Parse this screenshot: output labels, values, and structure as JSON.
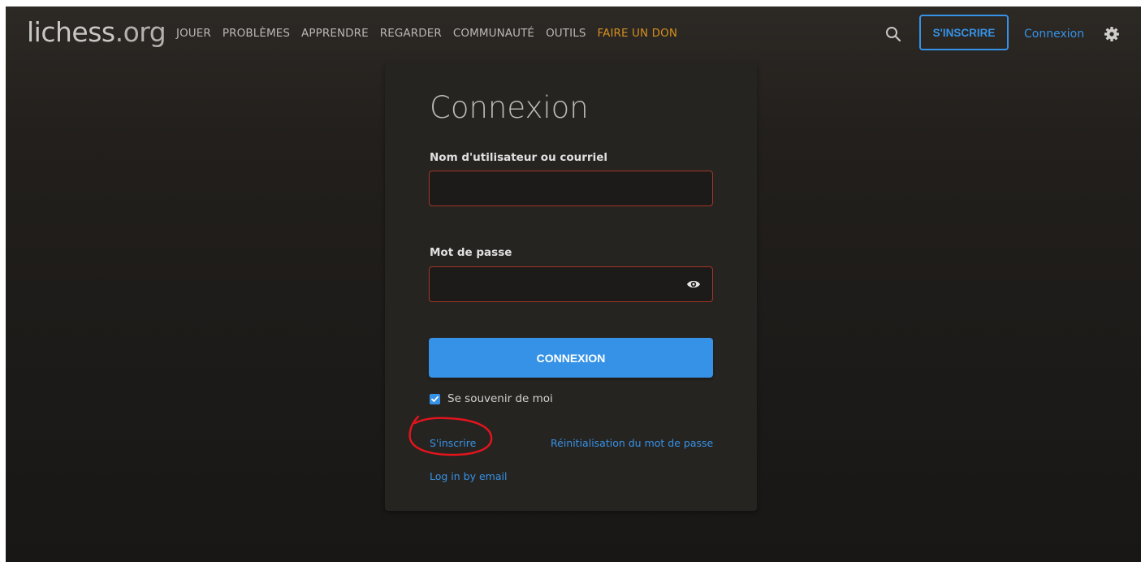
{
  "colors": {
    "accent": "#3692e7",
    "donate": "#d59020",
    "error_border": "#a23428",
    "annotation": "#e5141c"
  },
  "header": {
    "logo_name": "lichess",
    "logo_tld": ".org",
    "nav": [
      {
        "label": "JOUER"
      },
      {
        "label": "PROBLÈMES"
      },
      {
        "label": "APPRENDRE"
      },
      {
        "label": "REGARDER"
      },
      {
        "label": "COMMUNAUTÉ"
      },
      {
        "label": "OUTILS"
      },
      {
        "label": "FAIRE UN DON"
      }
    ],
    "search_icon": "search-icon",
    "signup_label": "S'INSCRIRE",
    "login_label": "Connexion",
    "settings_icon": "gear-icon"
  },
  "login": {
    "title": "Connexion",
    "username_label": "Nom d'utilisateur ou courriel",
    "username_value": "",
    "password_label": "Mot de passe",
    "password_value": "",
    "password_toggle_icon": "eye-icon",
    "submit_label": "CONNEXION",
    "remember_label": "Se souvenir de moi",
    "remember_checked": true,
    "signup_link": "S'inscrire",
    "reset_link": "Réinitialisation du mot de passe",
    "email_login_link": "Log in by email"
  },
  "annotation": {
    "shape": "hand-drawn circle",
    "target": "signup-link"
  }
}
